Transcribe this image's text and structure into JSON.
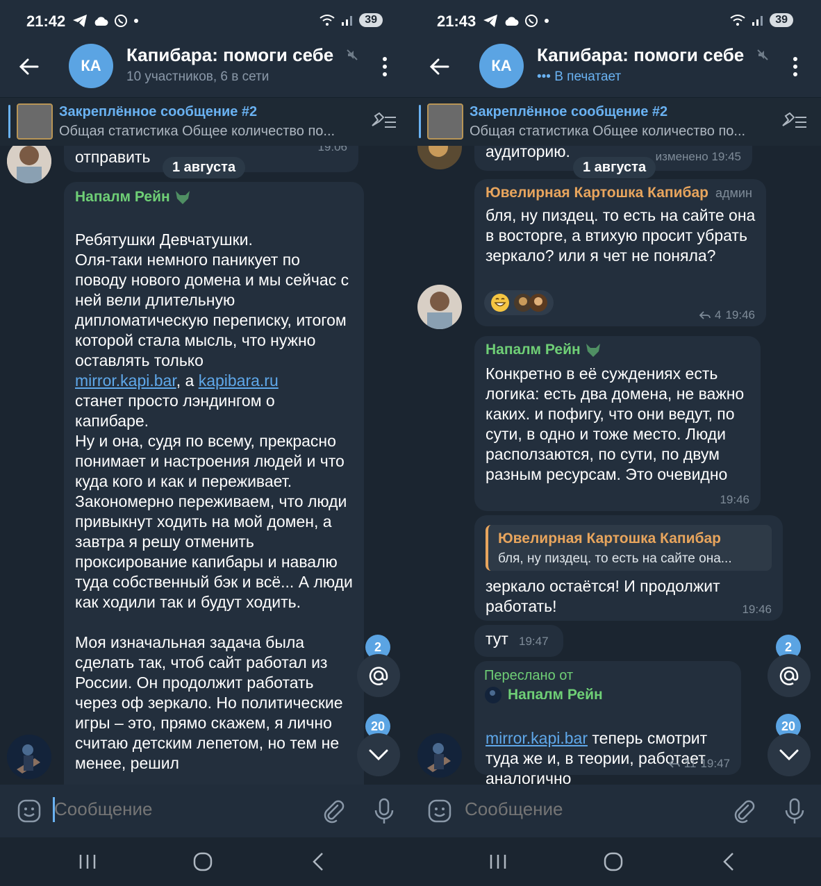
{
  "left": {
    "status": {
      "time": "21:42",
      "battery": "39"
    },
    "header": {
      "avatar_initials": "КА",
      "title": "Капибара: помоги себе",
      "subtitle": "10 участников, 6 в сети"
    },
    "pinned": {
      "title": "Закреплённое сообщение #2",
      "text": "Общая статистика Общее количество по..."
    },
    "msg0": {
      "text": "отправить",
      "time": "19:06"
    },
    "date": "1 августа",
    "msg1": {
      "sender": "Напалм Рейн",
      "line1": "Ребятушки Девчатушки.\nОля-таки немного паникует по поводу нового домена и мы сейчас с ней вели длительную дипломатическую переписку, итогом которой стала мысль, что нужно оставлять только",
      "link1": "mirror.kapi.bar",
      "mid": ", а ",
      "link2": "kapibara.ru",
      "line2": "станет просто лэндингом о капибаре.\nНу и она, судя по всему, прекрасно понимает и настроения людей и что куда кого и как и переживает.\nЗакономерно переживаем, что люди привыкнут ходить на мой домен, а завтра я решу отменить проксирование капибары и навалю туда собственный бэк и всё... А люди как ходили так и будут ходить.\n\nМоя изначальная задача была сделать так, чтоб сайт работал из России. Он продолжит работать через оф зеркало. Но политические игры – это, прямо скажем, я лично считаю детским лепетом, но тем не менее, решил"
    },
    "badge_mentions": "2",
    "badge_unread": "20",
    "input_placeholder": "Сообщение"
  },
  "right": {
    "status": {
      "time": "21:43",
      "battery": "39"
    },
    "header": {
      "avatar_initials": "КА",
      "title": "Капибара: помоги себе",
      "subtitle": "В печатает"
    },
    "pinned": {
      "title": "Закреплённое сообщение #2",
      "text": "Общая статистика Общее количество по..."
    },
    "msg0": {
      "text": "аудиторию.",
      "time": "изменено 19:45"
    },
    "date": "1 августа",
    "msg1": {
      "sender": "Ювелирная Картошка Капибар",
      "role": "админ",
      "text": "бля, ну пиздец. то есть на сайте она в восторге, а втихую просит убрать зеркало? или я чет не поняла?",
      "replies": "4",
      "time": "19:46"
    },
    "msg2": {
      "sender": "Напалм Рейн",
      "text": "Конкретно в её суждениях есть логика: есть два домена, не важно каких. и пофигу, что они ведут, по сути, в одно и тоже место. Люди расползаются, по сути, по двум разным ресурсам. Это очевидно",
      "time": "19:46"
    },
    "msg3": {
      "reply_sender": "Ювелирная Картошка Капибар",
      "reply_text": "бля, ну пиздец. то есть на сайте она...",
      "text": "зеркало остаётся! И продолжит работать!",
      "time": "19:46"
    },
    "msg4": {
      "text": "тут",
      "time": "19:47"
    },
    "msg5": {
      "forward_label": "Переслано от",
      "forward_name": "Напалм Рейн",
      "link": "mirror.kapi.bar",
      "text": " теперь смотрит туда же и, в теории, работает аналогично",
      "replies": "11",
      "time": "19:47"
    },
    "badge_mentions": "2",
    "badge_unread": "20",
    "input_placeholder": "Сообщение"
  },
  "colors": {
    "accent": "#5ba4e3",
    "link": "#5fa8ea",
    "green_sender": "#6fcf76",
    "orange_sender": "#e8a55d",
    "bubble": "#232f3d",
    "background": "#1b2530"
  },
  "icons": [
    "back-arrow-icon",
    "mute-icon",
    "more-vert-icon",
    "pin-list-icon",
    "emoji-icon",
    "attach-icon",
    "mic-icon",
    "mention-icon",
    "chevron-down-icon",
    "fox-icon"
  ]
}
